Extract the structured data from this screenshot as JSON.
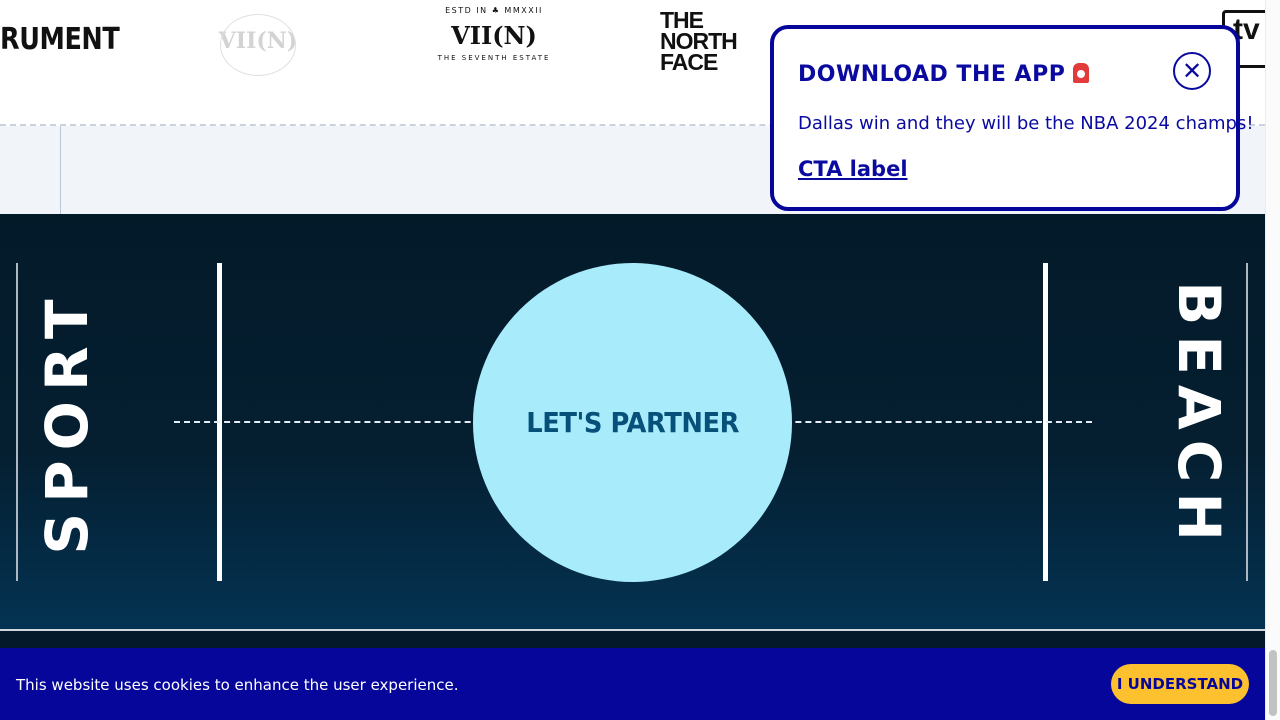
{
  "logos": {
    "instrument_text": "RUMENT",
    "faded_text": "VII(N)",
    "viin": {
      "estd": "ESTD IN",
      "year": "MMXXII",
      "mark": "VII(N)",
      "sub": "THE SEVENTH ESTATE"
    },
    "tnf": {
      "line1": "THE",
      "line2": "NORTH",
      "line3": "FACE"
    },
    "tv_text": "tv"
  },
  "court": {
    "left_word": "SPORT",
    "right_word": "BEACH",
    "cta_circle_label": "LET'S PARTNER"
  },
  "popup": {
    "title": "DOWNLOAD THE APP",
    "title_icon": "siren-icon",
    "close_icon": "close-icon",
    "close_glyph": "✕",
    "message": "Dallas win and they will be the NBA 2024 champs!",
    "cta": "CTA label"
  },
  "cookie": {
    "text": "This website uses cookies to enhance the user experience.",
    "button": "I UNDERSTAND"
  },
  "colors": {
    "brand_blue": "#06069b",
    "court_dark": "#031a29",
    "circle": "#a8ecfc",
    "cta_yellow": "#fdc12f"
  }
}
